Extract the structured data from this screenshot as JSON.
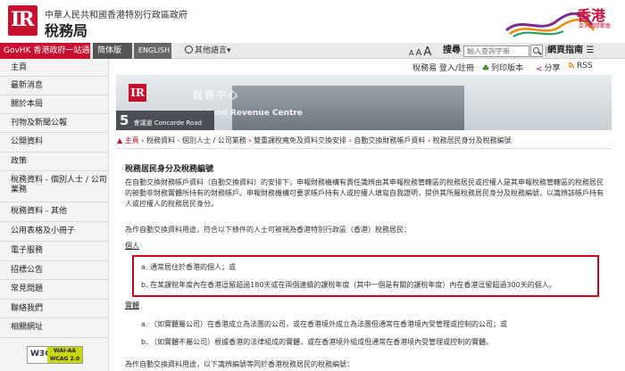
{
  "header": {
    "gov_name": "中華人民共和國香港特別行政區政府",
    "dept_name": "稅務局",
    "logo_text": "IR",
    "brand_text": "香港",
    "brand_sub": "亞洲國際都會"
  },
  "topnav": {
    "govhk": "GovHK 香港政府一站通",
    "simplified": "简体版",
    "english": "ENGLISH",
    "other_lang": "其他語言",
    "font_small": "A",
    "font_mid": "A",
    "font_large": "A",
    "search_label": "搜尋",
    "search_placeholder": "輸入查詢字串",
    "sitemap": "網頁指南"
  },
  "sidebar": {
    "items": [
      "主頁",
      "最新消息",
      "關於本局",
      "刊物及新聞公報",
      "公開資料",
      "政策",
      "稅務資料 - 個別人士 / 公司業務",
      "稅務資料 - 其他",
      "公用表格及小冊子",
      "電子服務",
      "招標公告",
      "常見問題",
      "聯絡我們",
      "相關網址"
    ],
    "badge_left": "W3C",
    "badge_right": "WAI-AA WCAG 2.0"
  },
  "toolbar": {
    "login": "稅務易 登入/註冊",
    "print": "列印版本",
    "share": "分享",
    "rss": "RSS"
  },
  "banner": {
    "logo": "IR",
    "plaque_cn": "稅務中心",
    "plaque_en": "Inland Revenue Centre",
    "address_num": "5",
    "address_sub": "會議道 Concorde Road"
  },
  "breadcrumb": {
    "items": [
      "主頁",
      "稅務資料 - 個別人士 / 公司業務",
      "雙重課稅寬免及資料交換安排",
      "自動交換財務帳戶資料",
      "稅務居民身分及稅務編號"
    ]
  },
  "content": {
    "title": "稅務居民身分及稅務編號",
    "para1": "在自動交換財務帳戶資料（自動交換資料）的安排下，申報財務機構有責任識辨由其申報稅務管轄區的稅務居民或控權人是其申報稅務管轄區的稅務居民的被動非財務實體所持有的財務帳戶。申報財務機構可要求帳戶持有人或控權人填寫自我證明，提供其所屬稅務居民身分及稅務編號，以識辨該帳戶持有人或控權人的稅務居民身分。",
    "para2": "為作自動交換資料用途，符合以下條件的人士可被視為香港特別行政區（香港）稅務居民：",
    "individual_heading": "個人",
    "individual_a": "a. 通常居住於香港的個人；或",
    "individual_b": "b. 在某課稅年度內在香港逗留超過180天或在兩個連續的課稅年度（其中一個是有關的課稅年度）內在香港逗留超過300天的個人。",
    "entity_heading": "實體",
    "entity_a": "a. （如實體屬公司）在香港成立為法團的公司，或在香港境外成立為法團但通常在香港境內受管理或控制的公司；或",
    "entity_b": "b. （如實體不屬公司）根據香港的法律組成的實體，或在香港境外組成但通常在香港境內受管理或控制的實體。",
    "footer_line": "為作自動交換資料用途，以下識辨編號等同於香港稅務居民的稅務編號："
  }
}
